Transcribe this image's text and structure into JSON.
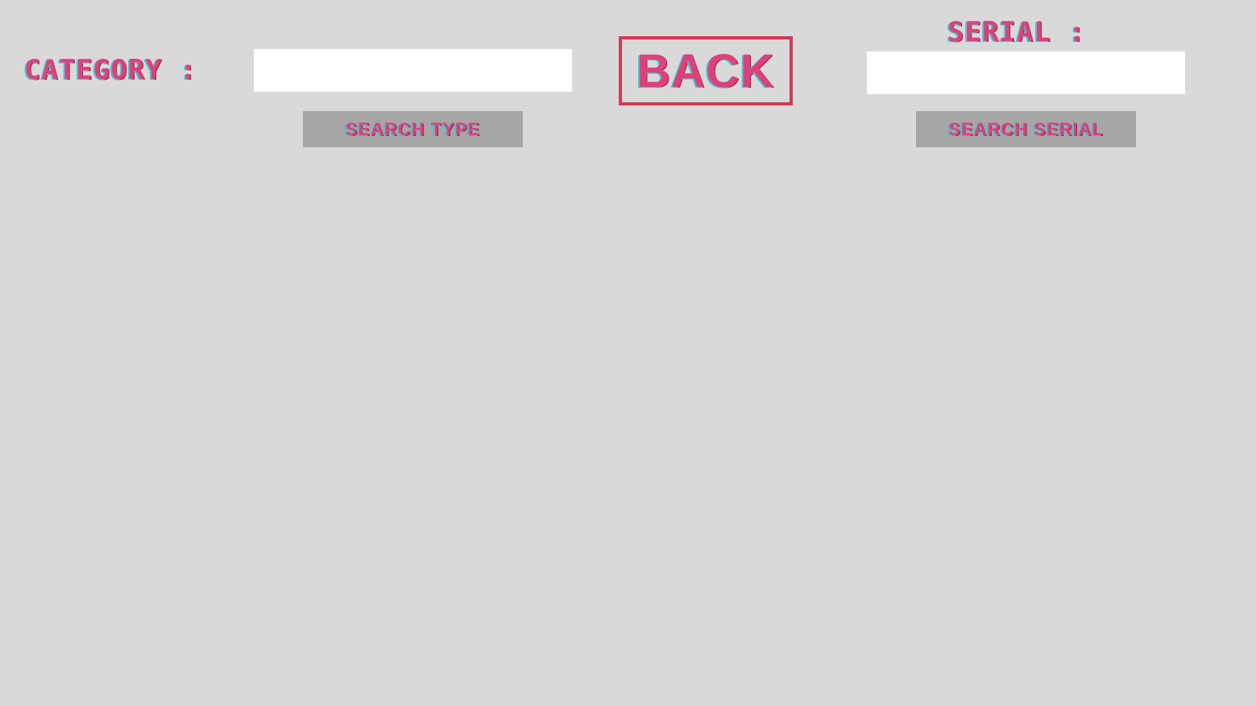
{
  "category": {
    "label": "CATEGORY :",
    "input_value": "",
    "input_placeholder": ""
  },
  "serial": {
    "label": "SERIAL :",
    "input_value": "",
    "input_placeholder": ""
  },
  "buttons": {
    "back": "BACK",
    "search_type": "SEARCH TYPE",
    "search_serial": "SEARCH SERIAL"
  },
  "colors": {
    "background": "#d9d9d9",
    "accent_text": "#e0407a",
    "text_shadow_cyan": "#3fc4d0",
    "back_border": "#d43a55",
    "button_gray": "#a6a6a6",
    "input_bg": "#ffffff"
  }
}
